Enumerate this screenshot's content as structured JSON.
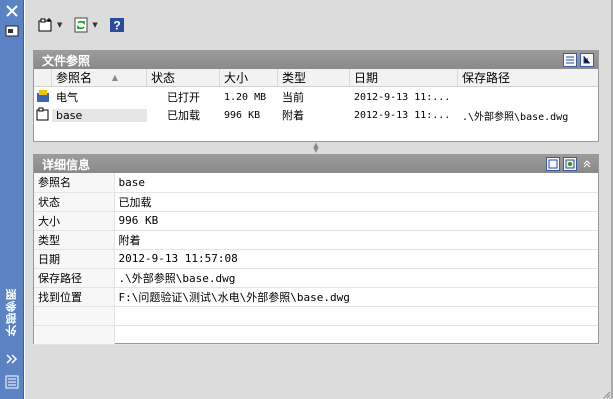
{
  "palette": {
    "side_bar": "#5b82c2",
    "panel_header": "#8f8f8f",
    "selection": "#e6e6e6",
    "workspace": "#dcdcdc"
  },
  "sidebar": {
    "title": "外部参照",
    "icons": [
      "close-icon",
      "properties-icon",
      "auto-hide-icon",
      "menu-icon"
    ]
  },
  "toolbar": {
    "icons": [
      "attach-dwg-icon",
      "refresh-icon",
      "help-icon"
    ]
  },
  "file_refs": {
    "title": "文件参照",
    "view_icons": [
      "list-view-icon",
      "tree-view-icon"
    ],
    "columns": [
      "参照名",
      "状态",
      "大小",
      "类型",
      "日期",
      "保存路径"
    ],
    "rows": [
      {
        "icon": "drawing-icon",
        "name": "电气",
        "status": "已打开",
        "size": "1.20 MB",
        "type": "当前",
        "date": "2012-9-13 11:...",
        "path": ""
      },
      {
        "icon": "xref-dwg-icon",
        "name": "base",
        "status": "已加载",
        "size": "996 KB",
        "type": "附着",
        "date": "2012-9-13 11:...",
        "path": ".\\外部参照\\base.dwg"
      }
    ]
  },
  "details": {
    "title": "详细信息",
    "icons": [
      "details-icon",
      "preview-icon",
      "collapse-icon"
    ],
    "rows": [
      {
        "key": "参照名",
        "value": "base"
      },
      {
        "key": "状态",
        "value": "已加载"
      },
      {
        "key": "大小",
        "value": "996 KB"
      },
      {
        "key": "类型",
        "value": "附着"
      },
      {
        "key": "日期",
        "value": "2012-9-13 11:57:08"
      },
      {
        "key": "保存路径",
        "value": ".\\外部参照\\base.dwg"
      },
      {
        "key": "找到位置",
        "value": "F:\\问题验证\\测试\\水电\\外部参照\\base.dwg"
      },
      {
        "key": "",
        "value": ""
      },
      {
        "key": "",
        "value": ""
      }
    ]
  }
}
